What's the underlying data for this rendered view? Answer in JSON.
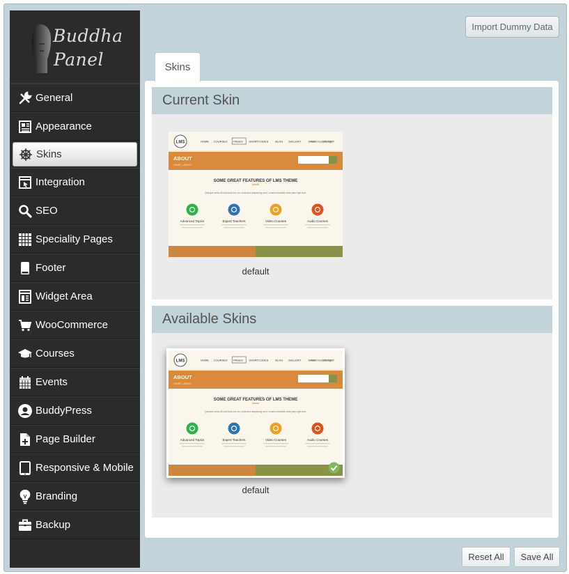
{
  "logo": {
    "line1": "Buddha",
    "line2": "Panel"
  },
  "nav": [
    {
      "label": "General",
      "icon": "wrench-icon"
    },
    {
      "label": "Appearance",
      "icon": "layout-icon"
    },
    {
      "label": "Skins",
      "icon": "ship-wheel-icon",
      "active": true
    },
    {
      "label": "Integration",
      "icon": "browser-window-icon"
    },
    {
      "label": "SEO",
      "icon": "search-icon"
    },
    {
      "label": "Speciality Pages",
      "icon": "grid-icon"
    },
    {
      "label": "Footer",
      "icon": "mobile-footer-icon"
    },
    {
      "label": "Widget Area",
      "icon": "widget-icon"
    },
    {
      "label": "WooCommerce",
      "icon": "cart-icon"
    },
    {
      "label": "Courses",
      "icon": "graduation-cap-icon"
    },
    {
      "label": "Events",
      "icon": "calendar-icon"
    },
    {
      "label": "BuddyPress",
      "icon": "user-circle-icon"
    },
    {
      "label": "Page Builder",
      "icon": "page-plus-icon"
    },
    {
      "label": "Responsive & Mobile",
      "icon": "tablet-icon"
    },
    {
      "label": "Branding",
      "icon": "lightbulb-icon"
    },
    {
      "label": "Backup",
      "icon": "briefcase-icon"
    }
  ],
  "import_button": "Import Dummy Data",
  "tab": "Skins",
  "current": {
    "title": "Current Skin",
    "skin_name": "default"
  },
  "available": {
    "title": "Available Skins",
    "skin_name": "default"
  },
  "reset_button": "Reset All",
  "save_button": "Save All",
  "preview": {
    "logo": "LMS",
    "menu": [
      "HOME",
      "COURSES",
      "PAGES",
      "SHORTCODES",
      "BLOG",
      "GALLERY",
      "SHOP",
      "CONTACT"
    ],
    "welcome": "Welcome, let's login",
    "banner_title": "ABOUT",
    "breadcrumb": "HOME > ABOUT",
    "headline": "SOME GREAT FEATURES OF LMS THEME",
    "subline": "Quisque semu dil sodi solo net um, nuda sed adspiscing sem, consect molestie enta justo eget erat.",
    "features": [
      {
        "label": "Advanced Topics",
        "color": "#2db34a"
      },
      {
        "label": "Expert Teachers",
        "color": "#2e74b5"
      },
      {
        "label": "Video Courses",
        "color": "#f0a020"
      },
      {
        "label": "Audio Courses",
        "color": "#e0521c"
      }
    ]
  },
  "colors": {
    "sidebar": "#2b2b2b",
    "accent": "#c2d4da",
    "preview_orange": "#d98a3c",
    "preview_olive": "#8a9248"
  }
}
